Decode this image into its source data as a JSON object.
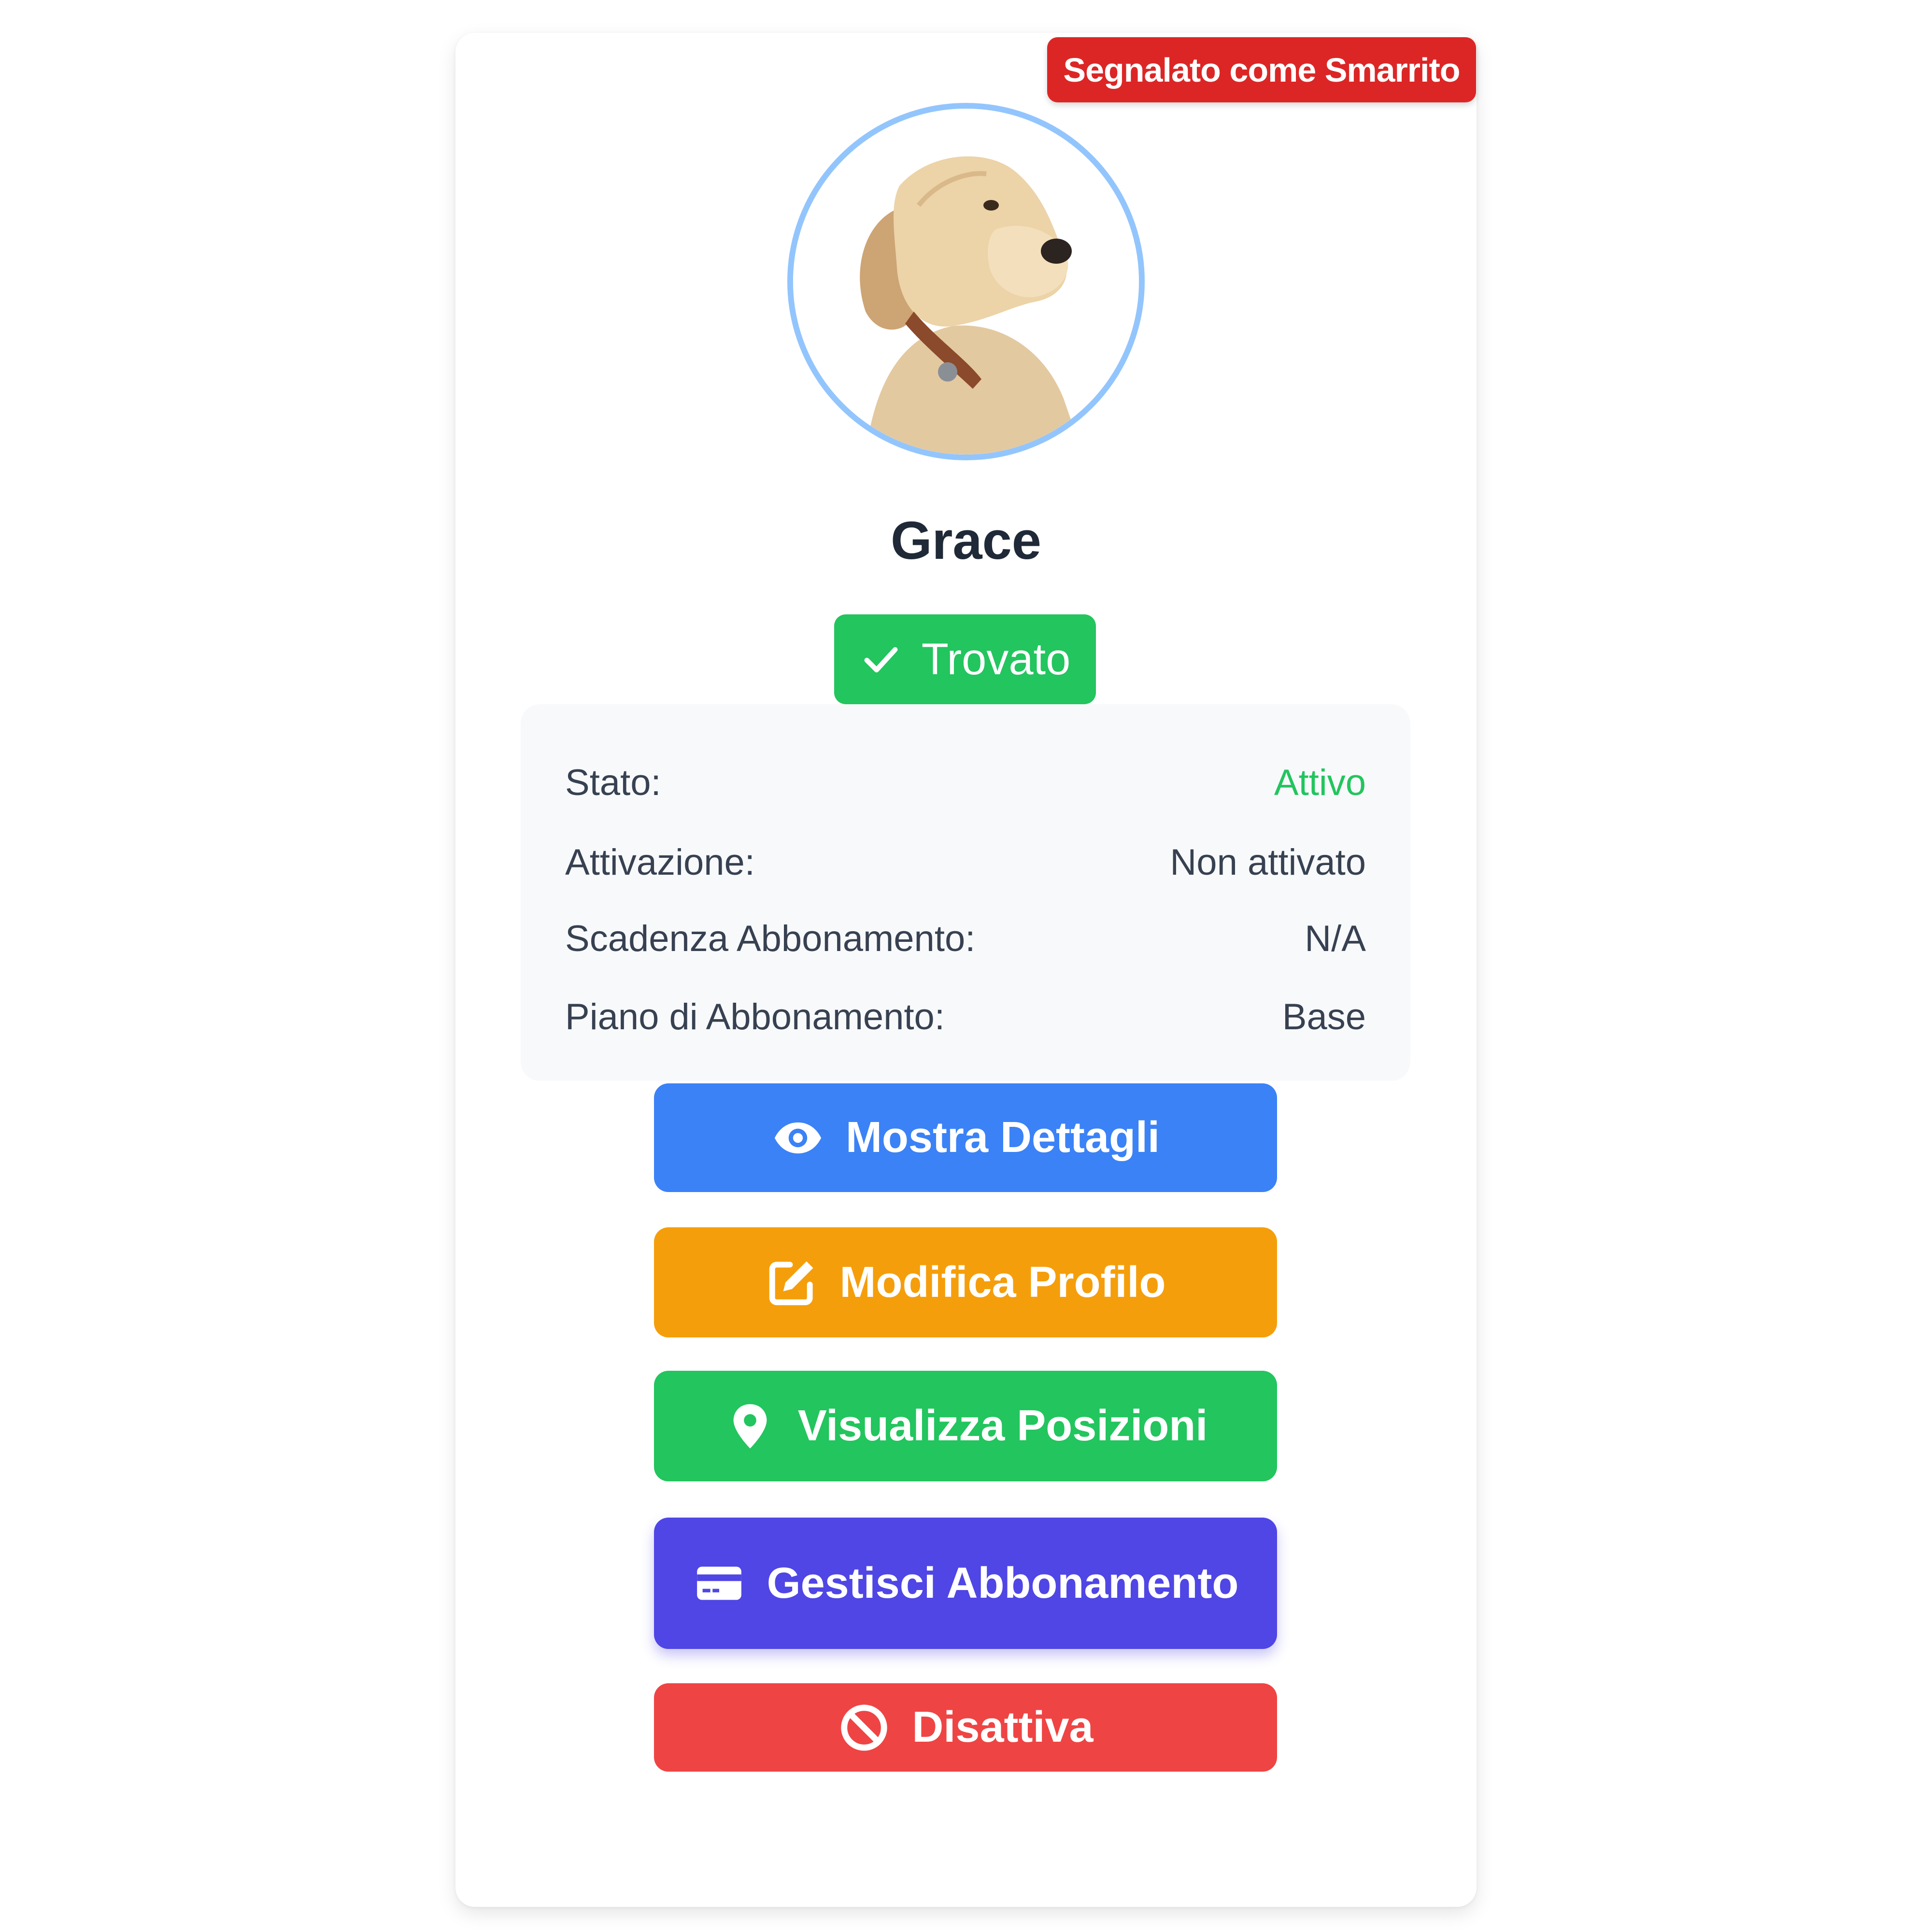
{
  "badges": {
    "lost": "Segnalato come Smarrito",
    "found": "Trovato"
  },
  "pet": {
    "name": "Grace",
    "photo": "dog-photo"
  },
  "info": [
    {
      "label": "Stato:",
      "value": "Attivo",
      "value_color": "#22c55e"
    },
    {
      "label": "Attivazione:",
      "value": "Non attivato"
    },
    {
      "label": "Scadenza Abbonamento:",
      "value": "N/A"
    },
    {
      "label": "Piano di Abbonamento:",
      "value": "Base"
    }
  ],
  "buttons": {
    "details": {
      "label": "Mostra Dettagli",
      "icon": "eye-icon",
      "color": "#3b82f6"
    },
    "edit": {
      "label": "Modifica Profilo",
      "icon": "edit-icon",
      "color": "#f59e0b"
    },
    "positions": {
      "label": "Visualizza Posizioni",
      "icon": "location-pin-icon",
      "color": "#22c55e"
    },
    "subscription": {
      "label": "Gestisci Abbonamento",
      "icon": "credit-card-icon",
      "color": "#4f46e5"
    },
    "deactivate": {
      "label": "Disattiva",
      "icon": "ban-icon",
      "color": "#ef4444"
    }
  },
  "colors": {
    "lost_badge": "#dc2626",
    "found_badge": "#22c55e",
    "avatar_ring": "#93c5fd"
  }
}
